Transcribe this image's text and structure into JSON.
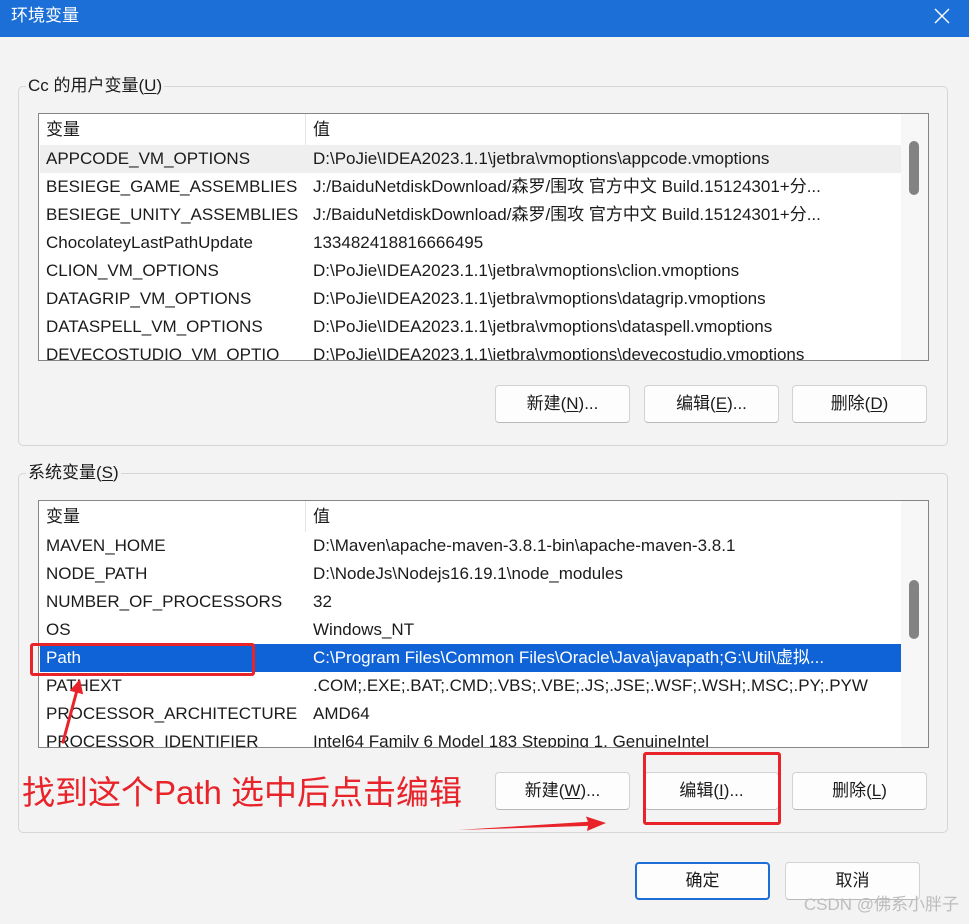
{
  "window": {
    "title": "环境变量",
    "close_icon": "close-icon"
  },
  "colors": {
    "title_bar": "#1b6fd6",
    "selection": "#0f63d6",
    "annotation": "#e8232a"
  },
  "user_variables": {
    "group_label": "Cc 的用户变量(U)",
    "columns": {
      "name": "变量",
      "value": "值"
    },
    "hover_index": 0,
    "selected_index": -1,
    "scrollbar": {
      "position": 0.11,
      "visible": 0.22
    },
    "rows": [
      {
        "name": "APPCODE_VM_OPTIONS",
        "value": "D:\\PoJie\\IDEA2023.1.1\\jetbra\\vmoptions\\appcode.vmoptions"
      },
      {
        "name": "BESIEGE_GAME_ASSEMBLIES",
        "value": "J:/BaiduNetdiskDownload/森罗/围攻 官方中文 Build.15124301+分..."
      },
      {
        "name": "BESIEGE_UNITY_ASSEMBLIES",
        "value": "J:/BaiduNetdiskDownload/森罗/围攻 官方中文 Build.15124301+分..."
      },
      {
        "name": "ChocolateyLastPathUpdate",
        "value": "133482418816666495"
      },
      {
        "name": "CLION_VM_OPTIONS",
        "value": "D:\\PoJie\\IDEA2023.1.1\\jetbra\\vmoptions\\clion.vmoptions"
      },
      {
        "name": "DATAGRIP_VM_OPTIONS",
        "value": "D:\\PoJie\\IDEA2023.1.1\\jetbra\\vmoptions\\datagrip.vmoptions"
      },
      {
        "name": "DATASPELL_VM_OPTIONS",
        "value": "D:\\PoJie\\IDEA2023.1.1\\jetbra\\vmoptions\\dataspell.vmoptions"
      },
      {
        "name": "DEVECOSTUDIO_VM_OPTIO",
        "value": "D:\\PoJie\\IDEA2023.1.1\\jetbra\\vmoptions\\devecostudio.vmoptions"
      }
    ],
    "buttons": {
      "new": "新建(N)...",
      "edit": "编辑(E)...",
      "delete": "删除(D)"
    }
  },
  "system_variables": {
    "group_label": "系统变量(S)",
    "columns": {
      "name": "变量",
      "value": "值"
    },
    "hover_index": -1,
    "selected_index": 4,
    "scrollbar": {
      "position": 0.32,
      "visible": 0.24
    },
    "rows": [
      {
        "name": "MAVEN_HOME",
        "value": "D:\\Maven\\apache-maven-3.8.1-bin\\apache-maven-3.8.1"
      },
      {
        "name": "NODE_PATH",
        "value": "D:\\NodeJs\\Nodejs16.19.1\\node_modules"
      },
      {
        "name": "NUMBER_OF_PROCESSORS",
        "value": "32"
      },
      {
        "name": "OS",
        "value": "Windows_NT"
      },
      {
        "name": "Path",
        "value": "C:\\Program Files\\Common Files\\Oracle\\Java\\javapath;G:\\Util\\虚拟..."
      },
      {
        "name": "PATHEXT",
        "value": ".COM;.EXE;.BAT;.CMD;.VBS;.VBE;.JS;.JSE;.WSF;.WSH;.MSC;.PY;.PYW"
      },
      {
        "name": "PROCESSOR_ARCHITECTURE",
        "value": "AMD64"
      },
      {
        "name": "PROCESSOR_IDENTIFIER",
        "value": "Intel64 Family 6 Model 183 Stepping 1, GenuineIntel"
      }
    ],
    "buttons": {
      "new": "新建(W)...",
      "edit": "编辑(I)...",
      "delete": "删除(L)"
    }
  },
  "annotation": {
    "text": "找到这个Path 选中后点击编辑"
  },
  "footer": {
    "ok": "确定",
    "cancel": "取消"
  },
  "watermark": "CSDN @佛系小胖子"
}
